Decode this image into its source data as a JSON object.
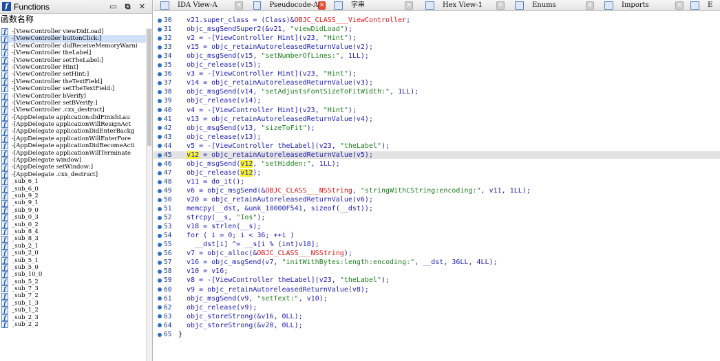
{
  "functions_pane": {
    "title": "Functions",
    "column_header": "函数名称",
    "functions": [
      "-[ViewController viewDidLoad]",
      "-[ViewController buttonClick:]",
      "-[ViewController didReceiveMemoryWarni",
      "-[ViewController theLabel]",
      "-[ViewController setTheLabel:]",
      "-[ViewController Hint]",
      "-[ViewController setHint:]",
      "-[ViewController theTextField]",
      "-[ViewController setTheTextField:]",
      "-[ViewController bVerify]",
      "-[ViewController setBVerify:]",
      "-[ViewController .cxx_destruct]",
      "-[AppDelegate application:didFinishLau",
      "-[AppDelegate applicationWillResignAct",
      "-[AppDelegate applicationDidEnterBackg",
      "-[AppDelegate applicationWillEnterFore",
      "-[AppDelegate applicationDidBecomeActi",
      "-[AppDelegate applicationWillTerminate",
      "-[AppDelegate window]",
      "-[AppDelegate setWindow:]",
      "-[AppDelegate .cxx_destruct]",
      "_sub_6_1",
      "_sub_6_0",
      "_sub_9_2",
      "_sub_9_1",
      "_sub_9_0",
      "_sub_0_3",
      "_sub_0_2",
      "_sub_8_4",
      "_sub_8_3",
      "_sub_2_1",
      "_sub_2_0",
      "_sub_5_1",
      "_sub_5_0",
      "_sub_10_0",
      "_sub_5_2",
      "_sub_7_3",
      "_sub_7_2",
      "_sub_1_3",
      "_sub_1_2",
      "_sub_2_3",
      "_sub_2_2"
    ],
    "selected_index": 1
  },
  "tabs": [
    {
      "label": "IDA View-A",
      "icon": "disassembly-icon",
      "active": false
    },
    {
      "label": "Pseudocode-A",
      "icon": "pseudocode-icon",
      "active": true
    },
    {
      "label": "字串",
      "icon": "strings-icon",
      "active": false
    },
    {
      "label": "Hex View-1",
      "icon": "hex-icon",
      "active": false
    },
    {
      "label": "Enums",
      "icon": "enums-icon",
      "active": false
    },
    {
      "label": "Imports",
      "icon": "imports-icon",
      "active": false
    },
    {
      "label": "E",
      "icon": "exports-icon",
      "active": false
    }
  ],
  "code": {
    "current_line": 45,
    "lines": [
      {
        "n": 30,
        "t": "  v21.super_class = (Class)&OBJC_CLASS___ViewController;"
      },
      {
        "n": 31,
        "t": "  objc_msgSendSuper2(&v21, \"viewDidLoad\");"
      },
      {
        "n": 32,
        "t": "  v2 = -[ViewController Hint](v23, \"Hint\");"
      },
      {
        "n": 33,
        "t": "  v15 = objc_retainAutoreleasedReturnValue(v2);"
      },
      {
        "n": 34,
        "t": "  objc_msgSend(v15, \"setNumberOfLines:\", 1LL);"
      },
      {
        "n": 35,
        "t": "  objc_release(v15);"
      },
      {
        "n": 36,
        "t": "  v3 = -[ViewController Hint](v23, \"Hint\");"
      },
      {
        "n": 37,
        "t": "  v14 = objc_retainAutoreleasedReturnValue(v3);"
      },
      {
        "n": 38,
        "t": "  objc_msgSend(v14, \"setAdjustsFontSizeToFitWidth:\", 1LL);"
      },
      {
        "n": 39,
        "t": "  objc_release(v14);"
      },
      {
        "n": 40,
        "t": "  v4 = -[ViewController Hint](v23, \"Hint\");"
      },
      {
        "n": 41,
        "t": "  v13 = objc_retainAutoreleasedReturnValue(v4);"
      },
      {
        "n": 42,
        "t": "  objc_msgSend(v13, \"sizeToFit\");"
      },
      {
        "n": 43,
        "t": "  objc_release(v13);"
      },
      {
        "n": 44,
        "t": "  v5 = -[ViewController theLabel](v23, \"theLabel\");"
      },
      {
        "n": 45,
        "t": "  v12 = objc_retainAutoreleasedReturnValue(v5);"
      },
      {
        "n": 46,
        "t": "  objc_msgSend(v12, \"setHidden:\", 1LL);"
      },
      {
        "n": 47,
        "t": "  objc_release(v12);"
      },
      {
        "n": 48,
        "t": "  v11 = do_it();"
      },
      {
        "n": 49,
        "t": "  v6 = objc_msgSend(&OBJC_CLASS___NSString, \"stringWithCString:encoding:\", v11, 1LL);"
      },
      {
        "n": 50,
        "t": "  v20 = objc_retainAutoreleasedReturnValue(v6);"
      },
      {
        "n": 51,
        "t": "  memcpy(__dst, &unk_10000F541, sizeof(__dst));"
      },
      {
        "n": 52,
        "t": "  strcpy(__s, \"Ios\");"
      },
      {
        "n": 53,
        "t": "  v18 = strlen(__s);"
      },
      {
        "n": 54,
        "t": "  for ( i = 0; i < 36; ++i )"
      },
      {
        "n": 55,
        "t": "    __dst[i] ^= __s[i % (int)v18];"
      },
      {
        "n": 56,
        "t": "  v7 = objc_alloc(&OBJC_CLASS___NSString);"
      },
      {
        "n": 57,
        "t": "  v16 = objc_msgSend(v7, \"initWithBytes:length:encoding:\", __dst, 36LL, 4LL);"
      },
      {
        "n": 58,
        "t": "  v10 = v16;"
      },
      {
        "n": 59,
        "t": "  v8 = -[ViewController theLabel](v23, \"theLabel\");"
      },
      {
        "n": 60,
        "t": "  v9 = objc_retainAutoreleasedReturnValue(v8);"
      },
      {
        "n": 61,
        "t": "  objc_msgSend(v9, \"setText:\", v10);"
      },
      {
        "n": 62,
        "t": "  objc_release(v9);"
      },
      {
        "n": 63,
        "t": "  objc_storeStrong(&v16, 0LL);"
      },
      {
        "n": 64,
        "t": "  objc_storeStrong(&v20, 0LL);"
      },
      {
        "n": 65,
        "t": "}"
      }
    ],
    "highlight_token": "v12"
  },
  "colors": {
    "code_text": "#1b1bb0",
    "string_literal": "#1e7d1e",
    "class_ref": "#dd1111",
    "highlight": "#f8f12f",
    "line_number": "#1e3a8a"
  }
}
